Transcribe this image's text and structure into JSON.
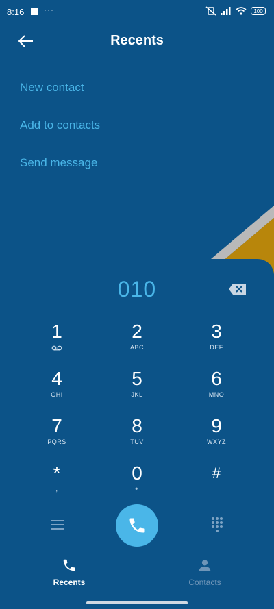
{
  "status_bar": {
    "time": "8:16",
    "dots": "···",
    "battery": "100"
  },
  "header": {
    "title": "Recents"
  },
  "actions": [
    "New contact",
    "Add to contacts",
    "Send message"
  ],
  "dialer": {
    "number": "010",
    "keys": [
      {
        "digit": "1",
        "letters": ""
      },
      {
        "digit": "2",
        "letters": "ABC"
      },
      {
        "digit": "3",
        "letters": "DEF"
      },
      {
        "digit": "4",
        "letters": "GHI"
      },
      {
        "digit": "5",
        "letters": "JKL"
      },
      {
        "digit": "6",
        "letters": "MNO"
      },
      {
        "digit": "7",
        "letters": "PQRS"
      },
      {
        "digit": "8",
        "letters": "TUV"
      },
      {
        "digit": "9",
        "letters": "WXYZ"
      },
      {
        "digit": "*",
        "letters": ","
      },
      {
        "digit": "0",
        "letters": "+"
      },
      {
        "digit": "#",
        "letters": ""
      }
    ]
  },
  "bottom_nav": {
    "recents": "Recents",
    "contacts": "Contacts"
  },
  "colors": {
    "background": "#0c5388",
    "accent": "#4ab6e8",
    "inactive": "#6e95b8"
  },
  "icons": {
    "back": "arrow-left-icon",
    "backspace": "backspace-icon",
    "voicemail": "voicemail-icon",
    "menu": "menu-icon",
    "call": "phone-icon",
    "dialpad": "dialpad-icon",
    "recents": "phone-icon",
    "contacts": "person-icon"
  }
}
